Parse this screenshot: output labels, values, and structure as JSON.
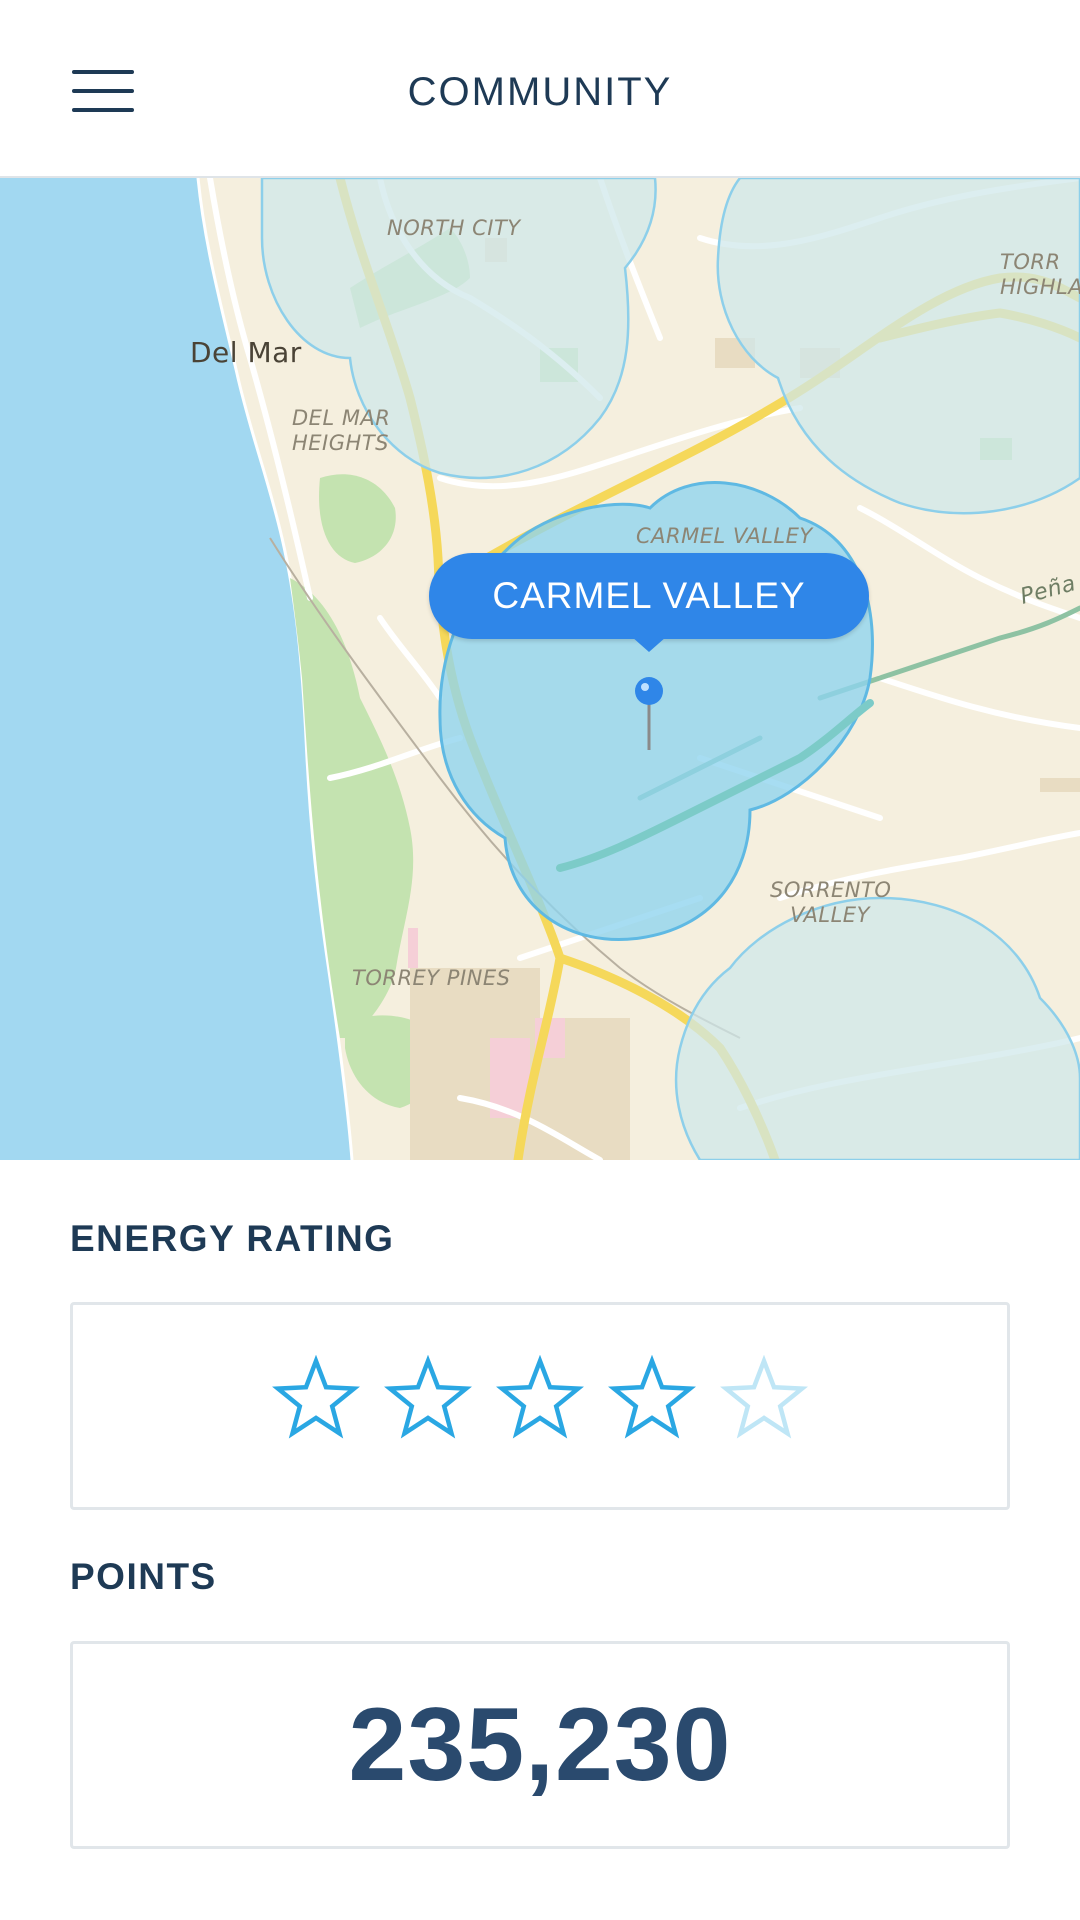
{
  "header": {
    "title": "COMMUNITY",
    "menu_icon": "hamburger-menu-icon"
  },
  "map": {
    "labels": {
      "north_city": "NORTH CITY",
      "del_mar": "Del Mar",
      "del_mar_heights": "DEL MAR HEIGHTS",
      "carmel_valley": "CARMEL VALLEY",
      "torrey_highlands": "TORR HIGHLA",
      "pena": "Peña",
      "sorrento_valley": "SORRENTO VALLEY",
      "torrey_pines": "TORREY PINES"
    },
    "callout": "CARMEL VALLEY",
    "colors": {
      "land": "#f5efde",
      "water": "#a2d8f1",
      "park": "#c4e3b0",
      "highway": "#f5d85a",
      "region_active": "#8ed3ee",
      "region_inactive": "#cfe7ea",
      "accent": "#2f86e8"
    }
  },
  "energy_rating": {
    "label": "ENERGY RATING",
    "rating": 4,
    "max": 5,
    "star_icon": "star-outline-icon"
  },
  "points": {
    "label": "POINTS",
    "value": "235,230"
  }
}
